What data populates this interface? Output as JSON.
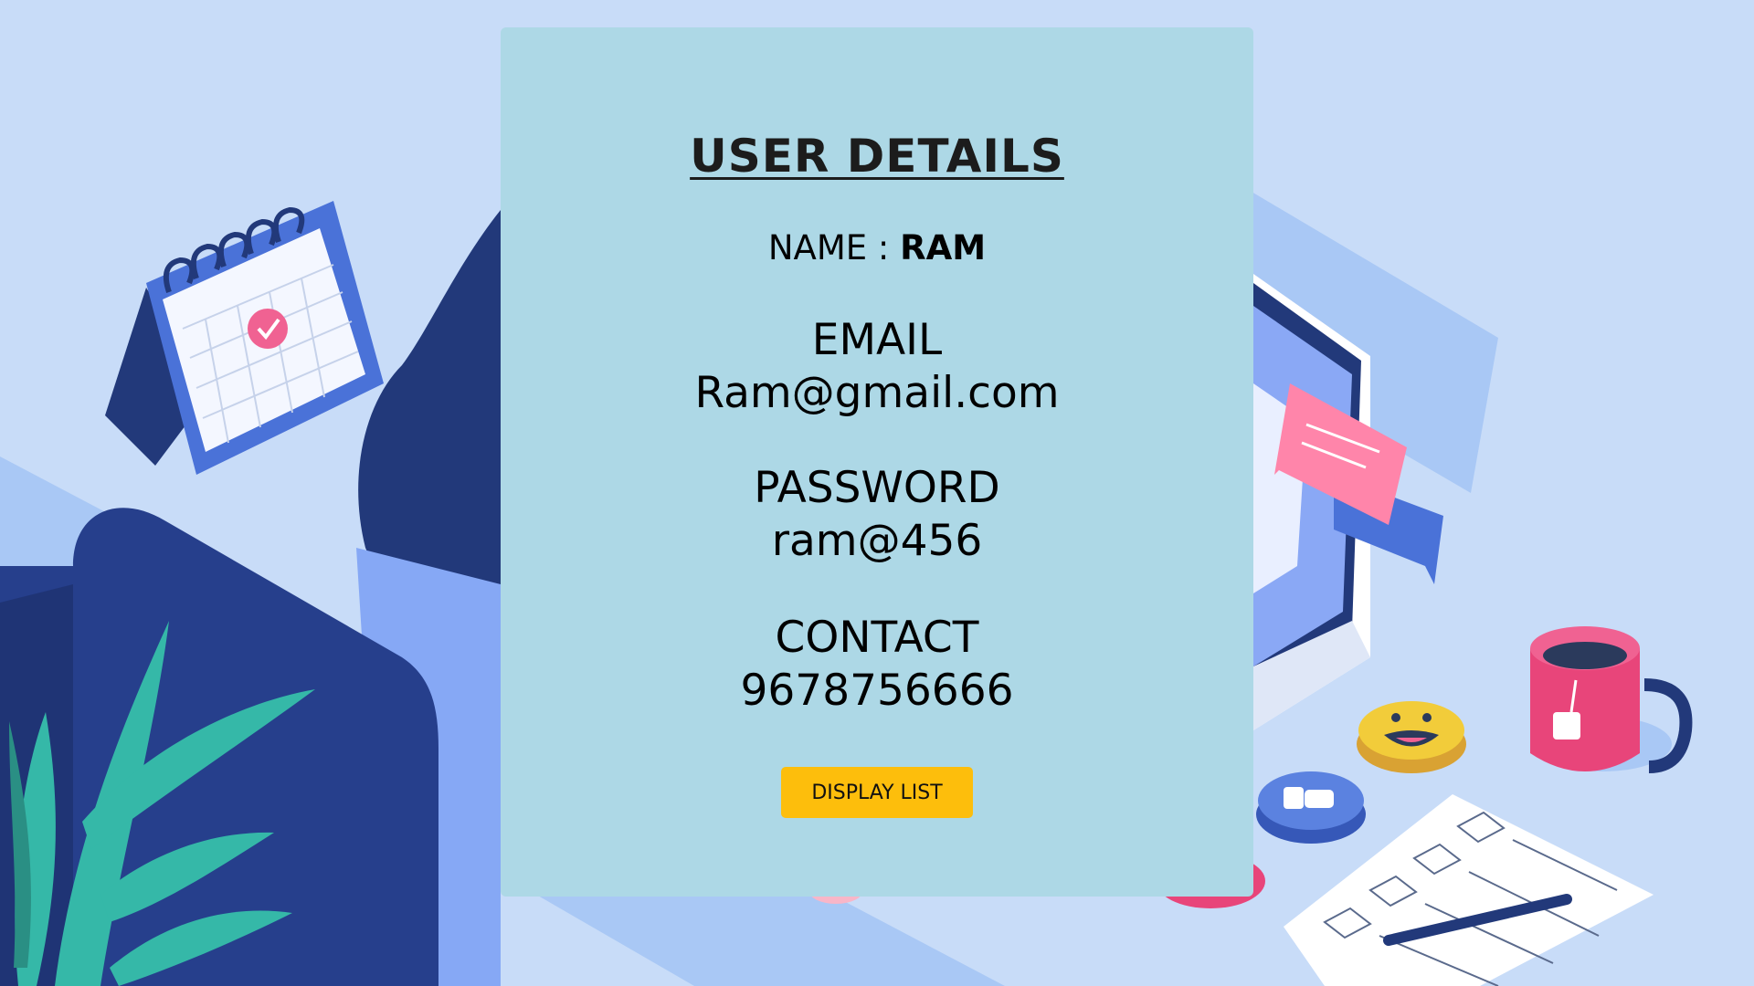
{
  "card": {
    "title": "USER DETAILS",
    "name_label": "NAME : ",
    "name_value": "RAM",
    "email_label": "EMAIL",
    "email_value": "Ram@gmail.com",
    "password_label": "PASSWORD",
    "password_value": "ram@456",
    "contact_label": "CONTACT",
    "contact_value": "9678756666",
    "button_label": "DISPLAY LIST"
  },
  "colors": {
    "background": "#c8dcf8",
    "card": "#add8e6",
    "button": "#fdbe0c",
    "illustration_dark_blue": "#22397a",
    "illustration_pink": "#f06292",
    "illustration_teal": "#35b8a8"
  }
}
